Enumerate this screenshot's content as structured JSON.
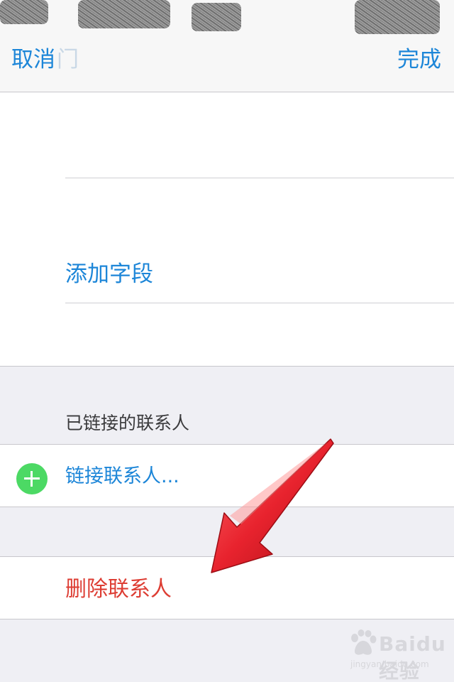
{
  "nav": {
    "cancel_label": "取消",
    "ghost_text": "门",
    "done_label": "完成"
  },
  "fields": {
    "add_field_label": "添加字段"
  },
  "linked_contacts": {
    "section_header": "已链接的联系人",
    "link_label": "链接联系人..."
  },
  "danger": {
    "delete_label": "删除联系人"
  },
  "watermark": {
    "brand": "Baidu经验",
    "url": "jingyan.baidu.com"
  },
  "colors": {
    "accent_blue": "#1d86d8",
    "delete_red": "#dd3d33",
    "add_green": "#4cd964",
    "arrow_red": "#e8232e"
  }
}
